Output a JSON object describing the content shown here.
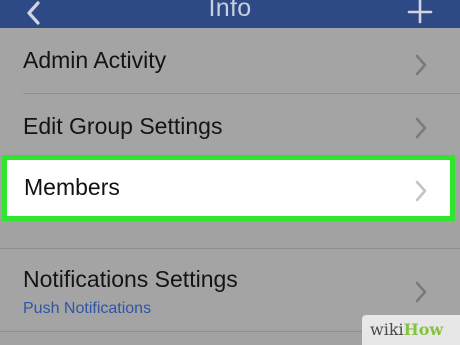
{
  "nav": {
    "title": "Info",
    "back_icon": "chevron-left-icon",
    "add_icon": "plus-icon"
  },
  "menu": {
    "admin_activity": "Admin Activity",
    "edit_group_settings": "Edit Group Settings",
    "members": "Members",
    "notifications_settings": "Notifications Settings",
    "notifications_subtitle": "Push Notifications"
  },
  "watermark": {
    "wiki": "wiki",
    "how": "How"
  },
  "colors": {
    "nav_bar": "#2e4a86",
    "highlight_border": "#2fe62f",
    "subtitle_text": "#2f54a8",
    "dimmed_background": "#a4a4a4"
  }
}
